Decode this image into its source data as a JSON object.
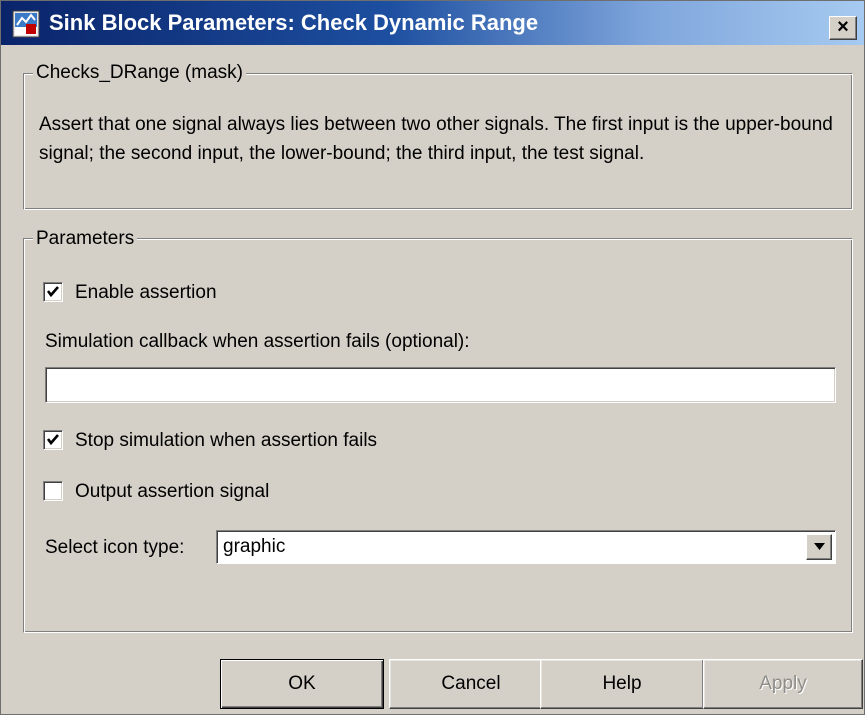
{
  "window": {
    "title": "Sink Block Parameters: Check Dynamic Range",
    "close_label": "×"
  },
  "mask_group": {
    "legend": "Checks_DRange (mask)",
    "description": "Assert that one signal always lies between two other signals.  The first input is the upper-bound signal; the second input, the lower-bound; the third input, the test signal."
  },
  "parameters": {
    "legend": "Parameters",
    "enable_assertion": {
      "label": "Enable assertion",
      "checked": true
    },
    "callback": {
      "label": "Simulation callback when assertion fails (optional):",
      "value": ""
    },
    "stop_simulation": {
      "label": "Stop simulation when assertion fails",
      "checked": true
    },
    "output_assertion": {
      "label": "Output assertion signal",
      "checked": false
    },
    "icon_type": {
      "label": "Select icon type:",
      "value": "graphic"
    }
  },
  "buttons": {
    "ok": "OK",
    "cancel": "Cancel",
    "help": "Help",
    "apply": "Apply"
  },
  "icons": {
    "title_icon": "simulink-block-icon",
    "close": "close-icon",
    "check": "checkmark-icon",
    "dropdown": "chevron-down-icon"
  },
  "colors": {
    "titlebar_start": "#0a246a",
    "titlebar_end": "#a6caf0",
    "dialog_bg": "#d4d0c8"
  }
}
